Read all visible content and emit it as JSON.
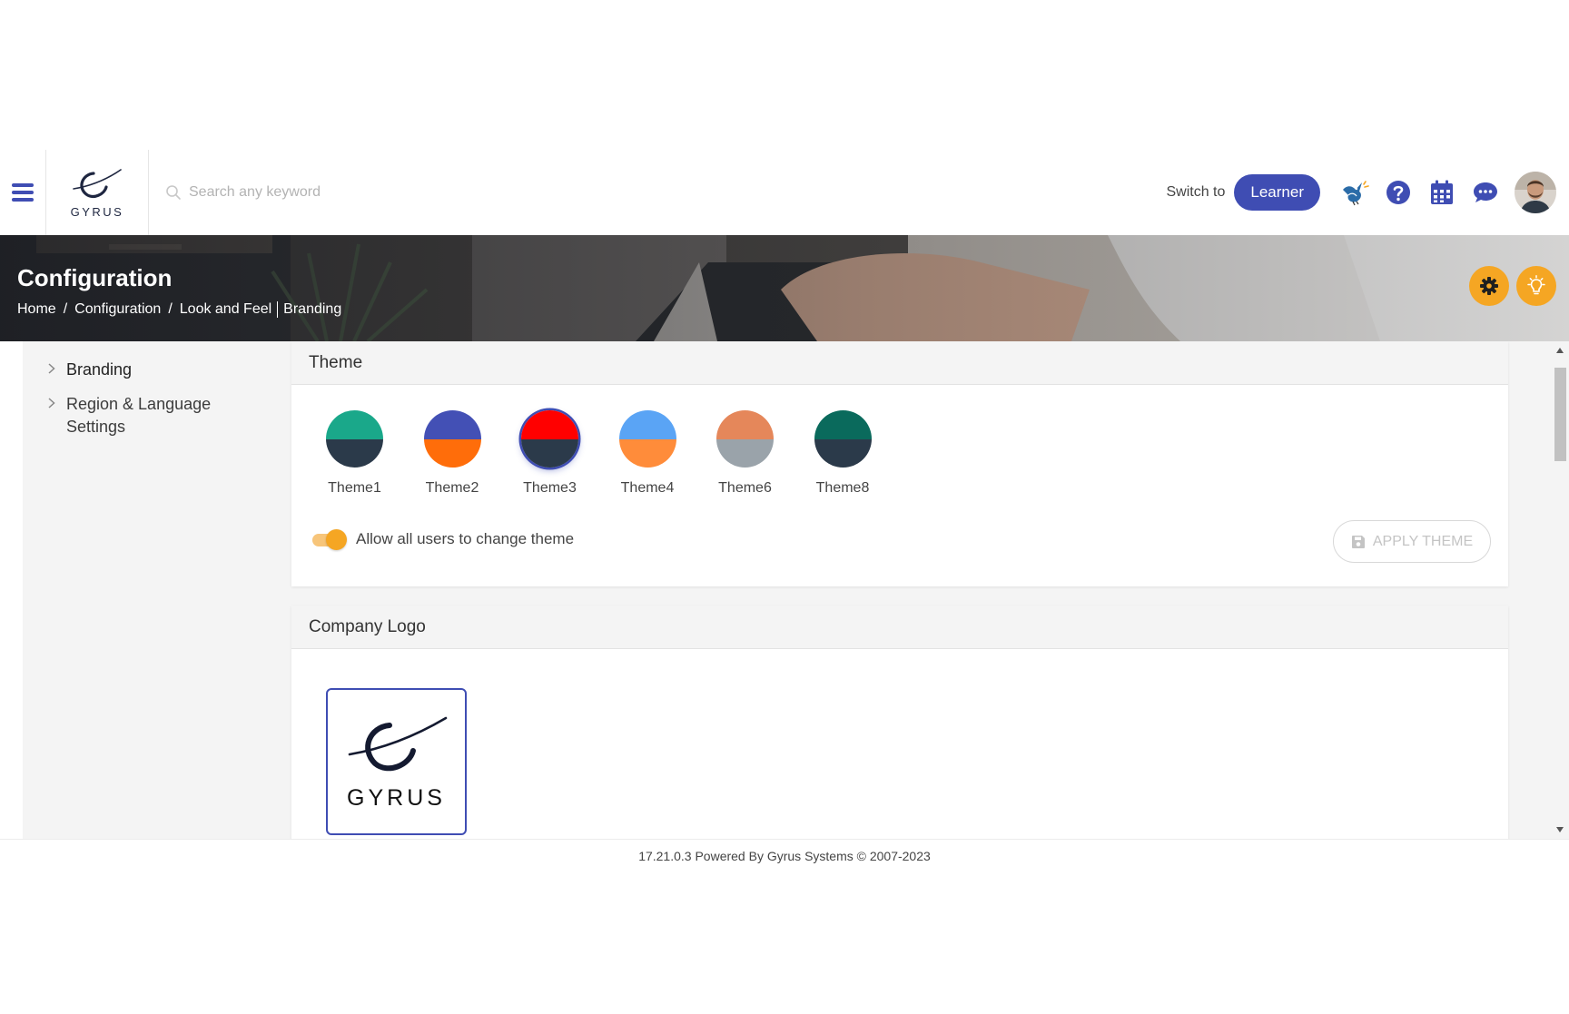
{
  "header": {
    "logo_text": "GYRUS",
    "search_placeholder": "Search any keyword",
    "switch_label": "Switch to",
    "learner_button": "Learner"
  },
  "banner": {
    "title": "Configuration",
    "breadcrumb": {
      "home": "Home",
      "sep1": "/",
      "configuration": "Configuration",
      "sep2": "/",
      "look_and_feel": "Look and Feel",
      "current": "Branding"
    }
  },
  "sidebar": {
    "items": [
      {
        "label": "Branding"
      },
      {
        "label": "Region & Language Settings"
      }
    ]
  },
  "theme_card": {
    "title": "Theme",
    "themes": [
      {
        "label": "Theme1",
        "top": "#1aa88a",
        "bottom": "#2b3a4a",
        "selected": false
      },
      {
        "label": "Theme2",
        "top": "#4350b5",
        "bottom": "#ff6d0a",
        "selected": false
      },
      {
        "label": "Theme3",
        "top": "#ff0000",
        "bottom": "#2b3a4a",
        "selected": true
      },
      {
        "label": "Theme4",
        "top": "#5aa4f5",
        "bottom": "#ff8c3a",
        "selected": false
      },
      {
        "label": "Theme6",
        "top": "#e5875a",
        "bottom": "#9aa3aa",
        "selected": false
      },
      {
        "label": "Theme8",
        "top": "#0a6a5c",
        "bottom": "#2b3a4a",
        "selected": false
      }
    ],
    "toggle_label": "Allow all users to change theme",
    "toggle_on": true,
    "apply_button": "APPLY THEME"
  },
  "logo_card": {
    "title": "Company Logo",
    "logo_text": "GYRUS"
  },
  "footer": {
    "text": "17.21.0.3 Powered By Gyrus Systems © 2007-2023"
  },
  "colors": {
    "primary": "#3f4db3",
    "accent": "#f5a623"
  }
}
